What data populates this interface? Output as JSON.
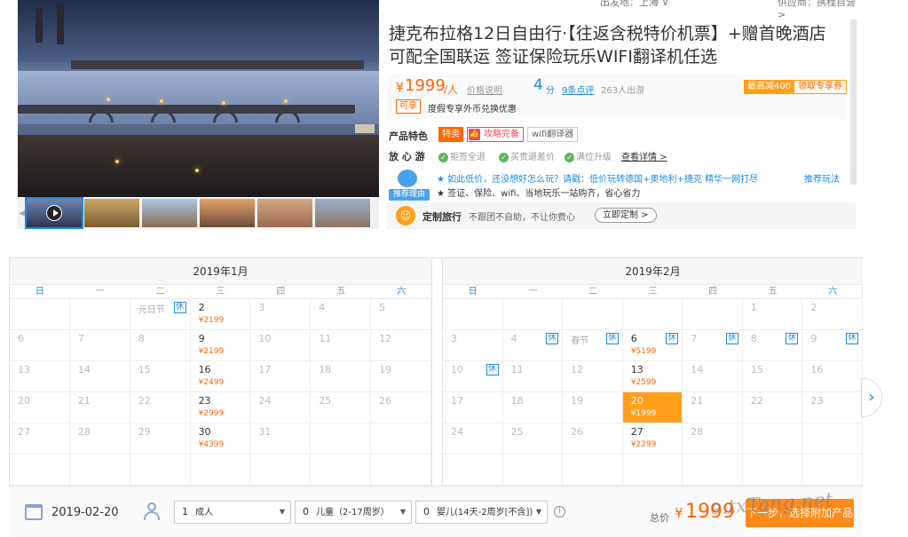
{
  "header": {
    "departure": "出发地：上海 ∨",
    "departure_right": "供应商：携程自营 >"
  },
  "product": {
    "title": "捷克布拉格12日自由行·【往返含税特价机票】+赠首晚酒店 可配全国联运 签证保险玩乐WIFI翻译机任选",
    "price_currency": "¥",
    "price_value": "1999",
    "price_unit": "/人",
    "price_note": "价格说明",
    "score": "4",
    "score_unit": "分",
    "reviews": "9条点评",
    "travelers": "263人出游",
    "coupon_max": "最高减400",
    "coupon_claim": "领取专享券",
    "tag_ok": "可享",
    "tag_ok_text": "度假专享外币兑换优惠"
  },
  "features": {
    "label": "产品特色",
    "items": [
      "特卖",
      "攻略完备",
      "wifi翻译器"
    ]
  },
  "safety": {
    "label": "放 心 游",
    "items": [
      "拒签全退",
      "买贵退差价",
      "满位升级"
    ],
    "detail": "查看详情 >"
  },
  "reason": {
    "badge": "推荐理由",
    "line1": "★ 如此低价，还没想好怎么玩？请戳：低价玩转德国+奥地利+捷克 精华一网打尽",
    "line2": "★ 签证、保险、wifi、当地玩乐一站购齐，省心省力",
    "more": "推荐玩法"
  },
  "custom": {
    "title": "定制旅行",
    "desc": "不跟团不自助，不让你费心",
    "button": "立即定制 >"
  },
  "calendar": {
    "weekdays": [
      "日",
      "一",
      "二",
      "三",
      "四",
      "五",
      "六"
    ],
    "holiday_label": "休",
    "months": [
      {
        "title": "2019年1月",
        "cells": [
          {
            "d": ""
          },
          {
            "d": ""
          },
          {
            "fest": "元日节",
            "hol": true
          },
          {
            "d": "2",
            "p": "¥2199"
          },
          {
            "d": "3"
          },
          {
            "d": "4"
          },
          {
            "d": "5"
          },
          {
            "d": "6"
          },
          {
            "d": "7"
          },
          {
            "d": "8"
          },
          {
            "d": "9",
            "p": "¥2199"
          },
          {
            "d": "10"
          },
          {
            "d": "11"
          },
          {
            "d": "12"
          },
          {
            "d": "13"
          },
          {
            "d": "14"
          },
          {
            "d": "15"
          },
          {
            "d": "16",
            "p": "¥2499"
          },
          {
            "d": "17"
          },
          {
            "d": "18"
          },
          {
            "d": "19"
          },
          {
            "d": "20"
          },
          {
            "d": "21"
          },
          {
            "d": "22"
          },
          {
            "d": "23",
            "p": "¥2999"
          },
          {
            "d": "24"
          },
          {
            "d": "25"
          },
          {
            "d": "26"
          },
          {
            "d": "27"
          },
          {
            "d": "28"
          },
          {
            "d": "29"
          },
          {
            "d": "30",
            "p": "¥4399"
          },
          {
            "d": "31"
          },
          {
            "d": ""
          },
          {
            "d": ""
          },
          {
            "d": ""
          },
          {
            "d": ""
          },
          {
            "d": ""
          },
          {
            "d": ""
          },
          {
            "d": ""
          },
          {
            "d": ""
          },
          {
            "d": ""
          }
        ]
      },
      {
        "title": "2019年2月",
        "cells": [
          {
            "d": ""
          },
          {
            "d": ""
          },
          {
            "d": ""
          },
          {
            "d": ""
          },
          {
            "d": ""
          },
          {
            "d": "1"
          },
          {
            "d": "2"
          },
          {
            "d": "3"
          },
          {
            "d": "4",
            "hol": true
          },
          {
            "fest": "春节",
            "hol": true
          },
          {
            "d": "6",
            "p": "¥5199",
            "hol": true
          },
          {
            "d": "7",
            "hol": true
          },
          {
            "d": "8",
            "hol": true
          },
          {
            "d": "9",
            "hol": true
          },
          {
            "d": "10",
            "hol": true
          },
          {
            "d": "11"
          },
          {
            "d": "12"
          },
          {
            "d": "13",
            "p": "¥2599"
          },
          {
            "d": "14"
          },
          {
            "d": "15"
          },
          {
            "d": "16"
          },
          {
            "d": "17"
          },
          {
            "d": "18"
          },
          {
            "d": "19"
          },
          {
            "d": "20",
            "p": "¥1999",
            "sel": true
          },
          {
            "d": "21"
          },
          {
            "d": "22"
          },
          {
            "d": "23"
          },
          {
            "d": "24"
          },
          {
            "d": "25"
          },
          {
            "d": "26"
          },
          {
            "d": "27",
            "p": "¥2299"
          },
          {
            "d": "28"
          },
          {
            "d": ""
          },
          {
            "d": ""
          },
          {
            "d": ""
          },
          {
            "d": ""
          },
          {
            "d": ""
          },
          {
            "d": ""
          },
          {
            "d": ""
          },
          {
            "d": ""
          },
          {
            "d": ""
          }
        ]
      }
    ]
  },
  "booking": {
    "date": "2019-02-20",
    "adults_num": "1",
    "adults_label": "成人",
    "children_num": "0",
    "children_label": "儿童（2-17周岁）",
    "infants_num": "0",
    "infants_label": "婴儿(14天-2周岁[不含])",
    "total_label": "总价",
    "total_currency": "¥",
    "total_value": "1999",
    "button": "下一步，选择附加产品"
  },
  "watermark": "e.txTang.net",
  "colors": {
    "accent": "#ff8b1b",
    "price": "#ff6600",
    "link": "#1f8be0"
  }
}
